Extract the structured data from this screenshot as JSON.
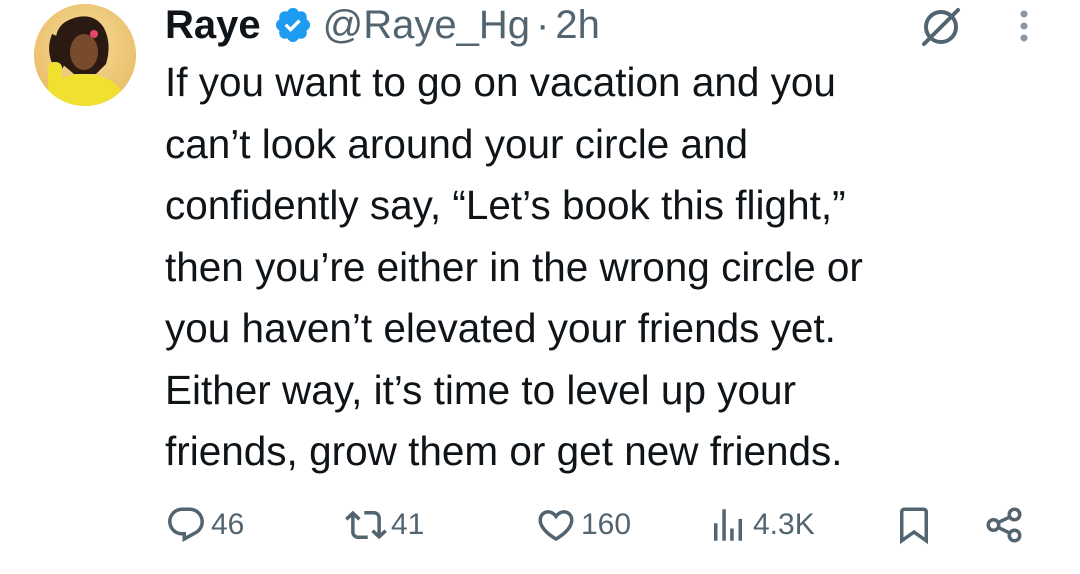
{
  "post": {
    "author": {
      "name": "Raye",
      "handle": "@Raye_Hg",
      "separator": "·",
      "time": "2h",
      "verified": true
    },
    "text_lines": [
      "If you want to go on vacation and you",
      "can’t look around your circle and",
      "confidently say, “Let’s book this flight,”",
      "then you’re either in the wrong circle or",
      "you haven’t elevated your friends yet.",
      "Either way, it’s time to level up your",
      "friends, grow them or get new friends."
    ],
    "actions": {
      "replies": "46",
      "reposts": "41",
      "likes": "160",
      "views": "4.3K"
    }
  },
  "icons": {
    "verified": "verified-badge-icon",
    "grok": "grok-icon",
    "more": "more-options-icon",
    "reply": "reply-icon",
    "repost": "repost-icon",
    "like": "heart-icon",
    "views": "views-icon",
    "bookmark": "bookmark-icon",
    "share": "share-icon"
  },
  "colors": {
    "text": "#0f1419",
    "secondary": "#536471",
    "verified": "#1d9bf0"
  }
}
